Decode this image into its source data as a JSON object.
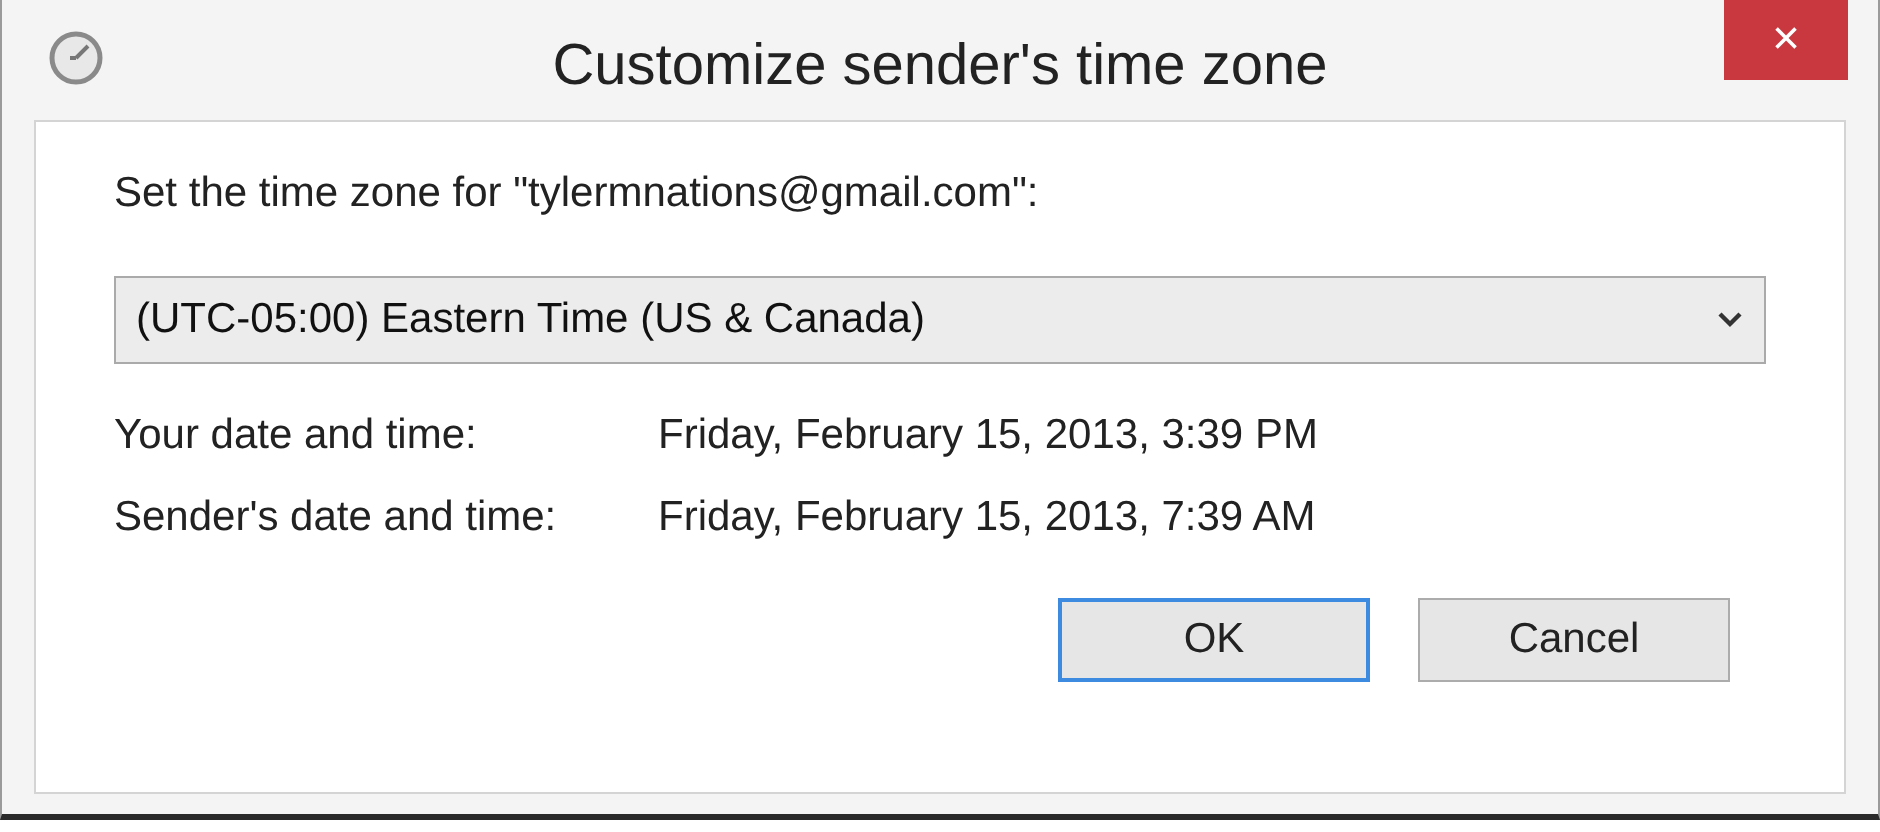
{
  "window": {
    "title": "Customize sender's time zone",
    "close": "×"
  },
  "prompt": "Set the time zone for \"tylermnations@gmail.com\":",
  "time_zone_select": {
    "value": "(UTC-05:00) Eastern Time (US & Canada)"
  },
  "times": [
    {
      "label": "Your date and time:",
      "value": "Friday, February 15, 2013, 3:39 PM"
    },
    {
      "label": "Sender's date and time:",
      "value": "Friday, February 15, 2013, 7:39 AM"
    }
  ],
  "buttons": [
    {
      "label": "OK",
      "default": true
    },
    {
      "label": "Cancel",
      "default": false
    }
  ]
}
